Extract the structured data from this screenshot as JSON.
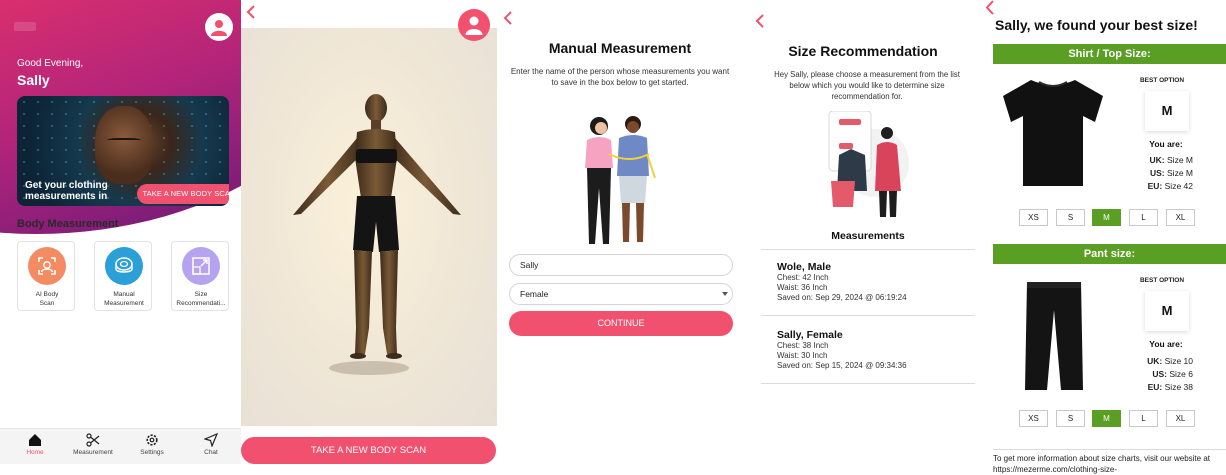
{
  "screen1": {
    "greeting": "Good Evening,",
    "user_name": "Sally",
    "banner_title": "Get your clothing measurements in minutes",
    "banner_button": "TAKE A NEW BODY SCAN",
    "section_title": "Body Measurement",
    "cards": [
      {
        "label": "AI Body Scan",
        "icon": "scan-face-icon",
        "color": "#f58b63"
      },
      {
        "label": "Manual Measurement",
        "icon": "tape-measure-icon",
        "color": "#2a9fd8"
      },
      {
        "label": "Size Recommendati...",
        "icon": "resize-icon",
        "color": "#b6a3f0"
      }
    ],
    "nav": [
      {
        "label": "Home",
        "icon": "home-icon",
        "active": true
      },
      {
        "label": "Measurement",
        "icon": "scissors-icon"
      },
      {
        "label": "Settings",
        "icon": "gear-icon"
      },
      {
        "label": "Chat",
        "icon": "send-icon"
      }
    ]
  },
  "screen2": {
    "button": "TAKE A NEW BODY SCAN"
  },
  "screen3": {
    "title": "Manual Measurement",
    "description": "Enter the name of the person whose measurements you want to save in the box below to get started.",
    "name_value": "Sally",
    "gender_value": "Female",
    "button": "CONTINUE"
  },
  "screen4": {
    "title": "Size Recommendation",
    "description": "Hey Sally, please choose a measurement from the list below which you would like to determine size recommendation for.",
    "measurements_title": "Measurements",
    "items": [
      {
        "name": "Wole, Male",
        "chest": "Chest: 42 Inch",
        "waist": "Waist: 36 Inch",
        "saved": "Saved on: Sep 29, 2024 @ 06:19:24"
      },
      {
        "name": "Sally, Female",
        "chest": "Chest: 38 Inch",
        "waist": "Waist: 30 Inch",
        "saved": "Saved on: Sep 15, 2024 @ 09:34:36"
      }
    ]
  },
  "screen5": {
    "title": "Sally, we found your best size!",
    "shirt": {
      "header": "Shirt / Top Size:",
      "best_label": "BEST OPTION",
      "best_size": "M",
      "you_are": "You are:",
      "uk_label": "UK:",
      "uk_value": "Size M",
      "us_label": "US:",
      "us_value": "Size M",
      "eu_label": "EU:",
      "eu_value": "Size 42",
      "sizes": [
        "XS",
        "S",
        "M",
        "L",
        "XL"
      ],
      "selected": "M"
    },
    "pant": {
      "header": "Pant size:",
      "best_label": "BEST OPTION",
      "best_size": "M",
      "you_are": "You are:",
      "uk_label": "UK:",
      "uk_value": "Size 10",
      "us_label": "US:",
      "us_value": "Size 6",
      "eu_label": "EU:",
      "eu_value": "Size 38",
      "sizes": [
        "XS",
        "S",
        "M",
        "L",
        "XL"
      ],
      "selected": "M"
    },
    "footer": "To get more information about size charts, visit our website at https://mezerme.com/clothing-size-"
  },
  "colors": {
    "accent": "#f2506f",
    "green": "#5a9e23",
    "hero_start": "#d92f6e",
    "hero_end": "#6e1a78"
  }
}
